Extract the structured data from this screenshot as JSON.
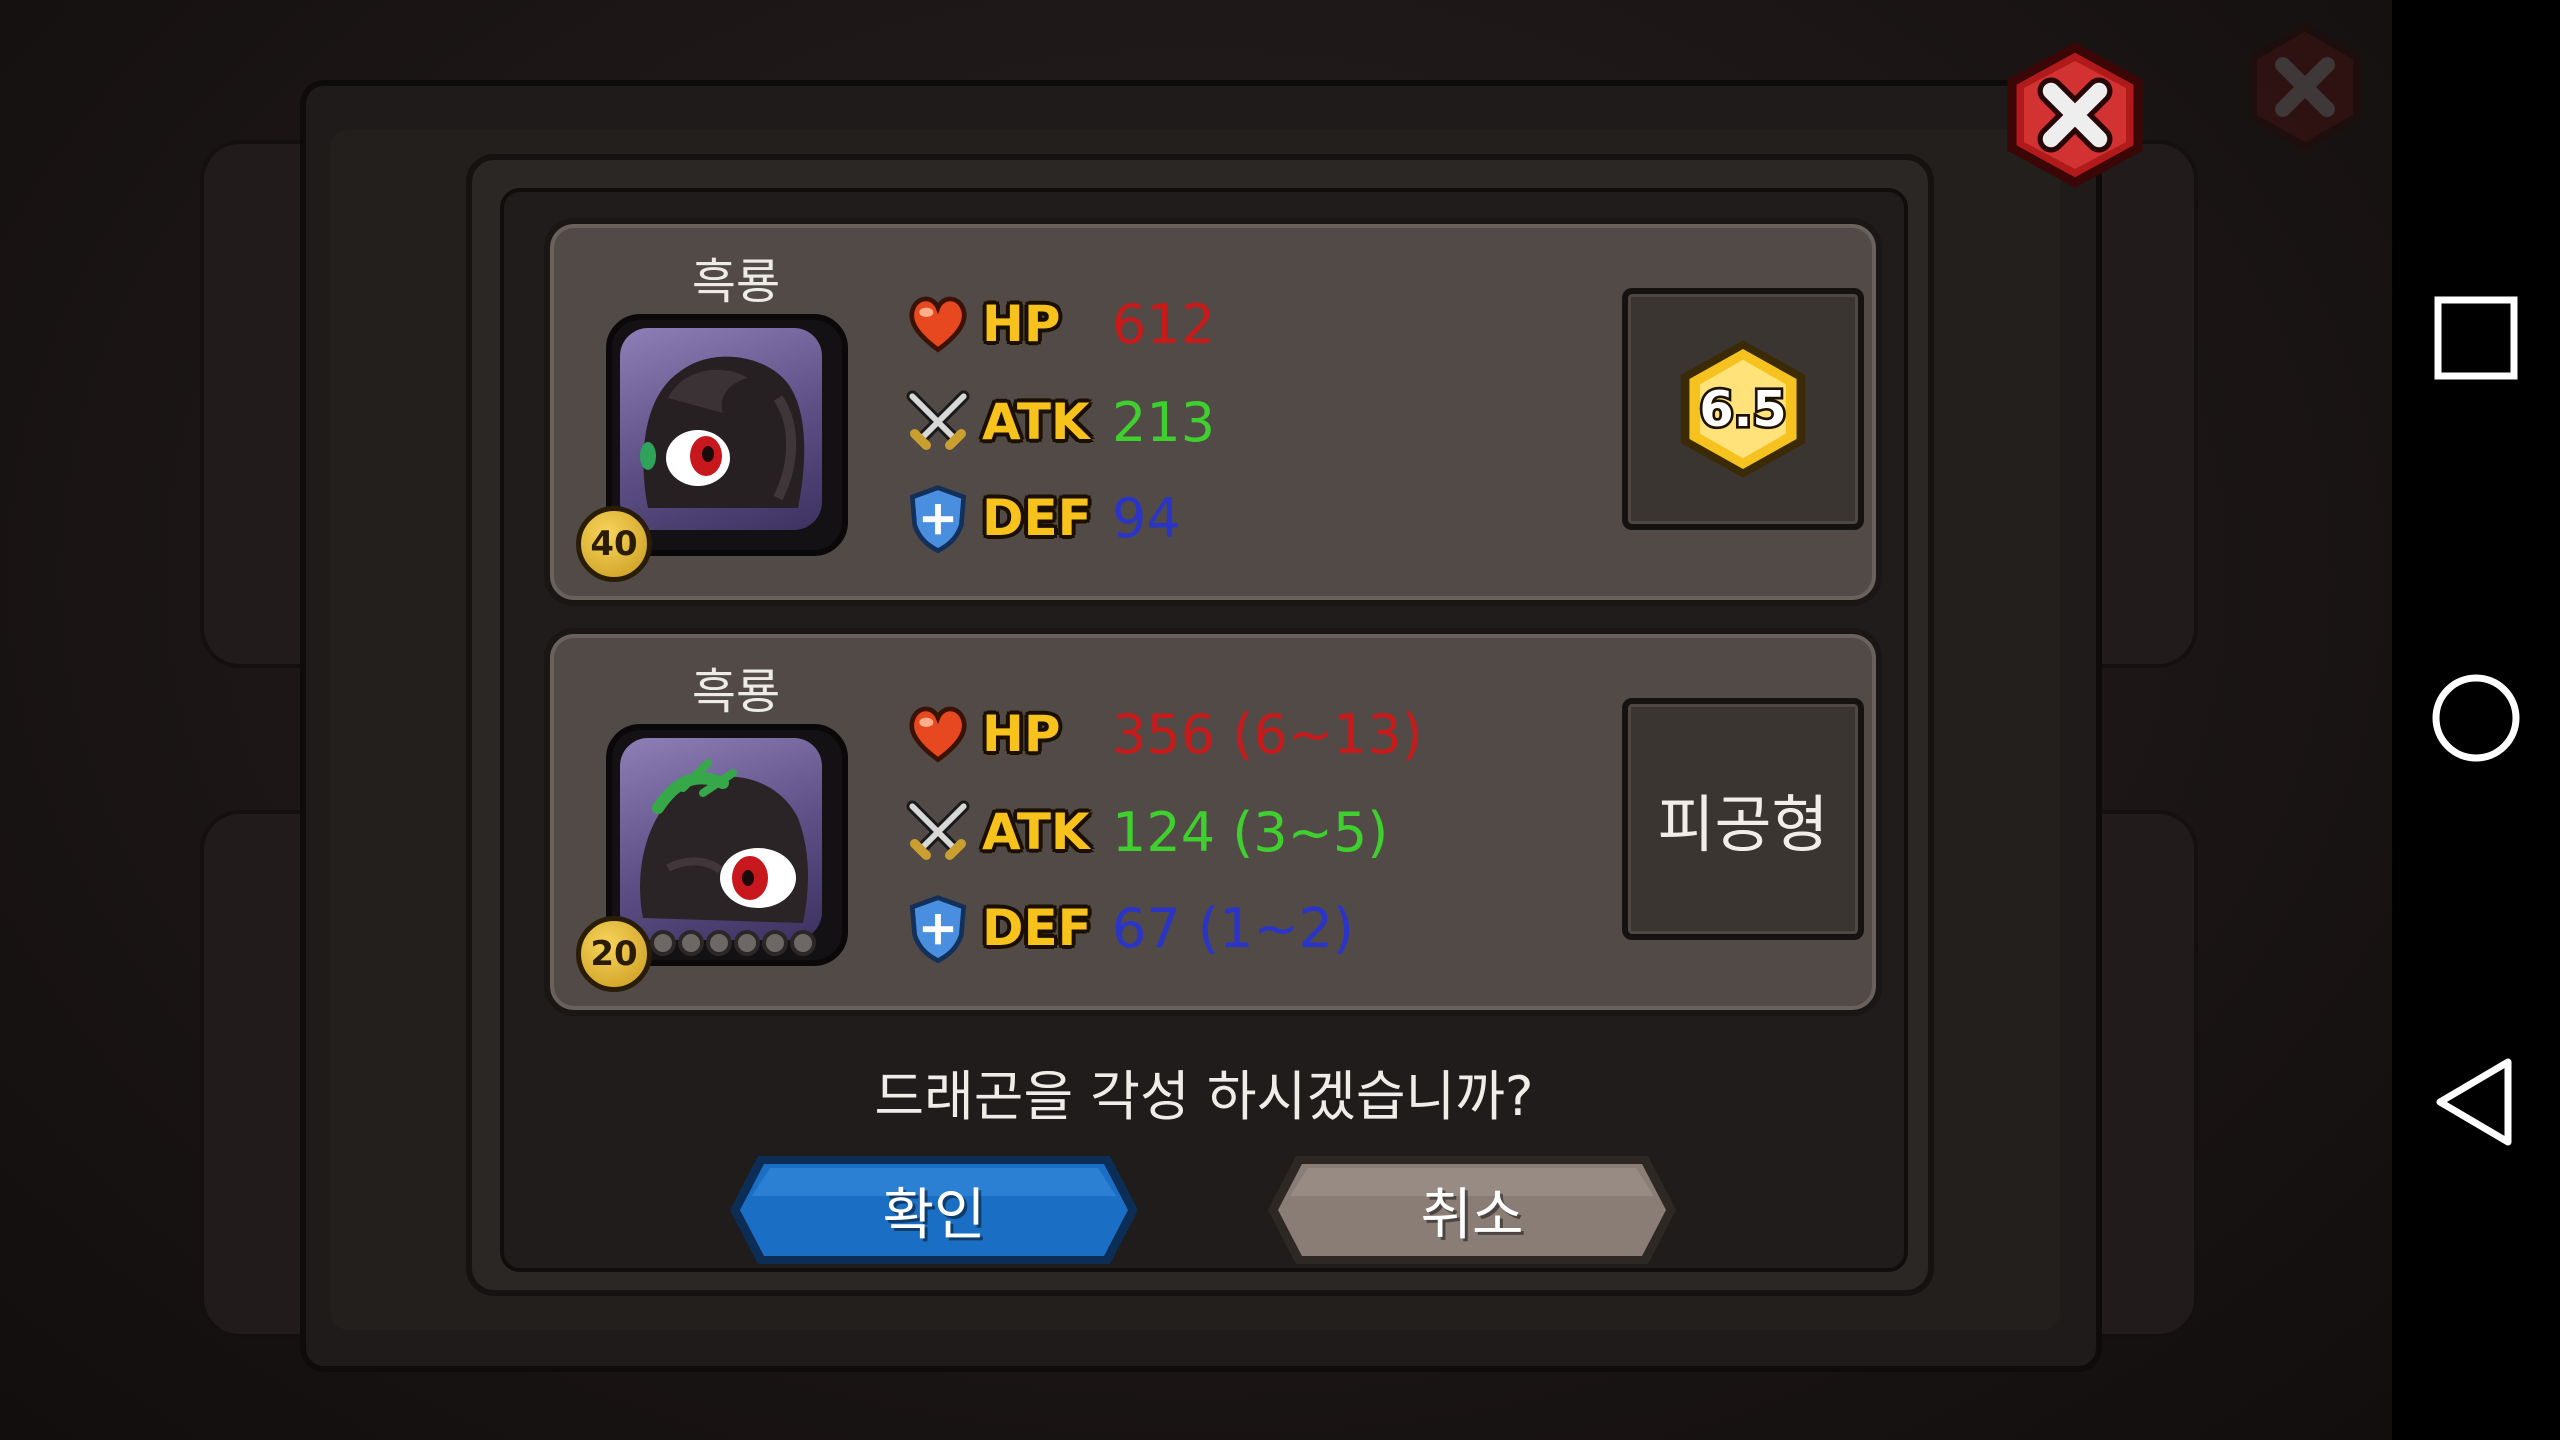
{
  "dragons": [
    {
      "name": "흑룡",
      "level": "40",
      "stats": {
        "hp_label": "HP",
        "hp_value": "612",
        "atk_label": "ATK",
        "atk_value": "213",
        "def_label": "DEF",
        "def_value": "94"
      },
      "side_box": {
        "type": "grade-badge",
        "text": "6.5"
      }
    },
    {
      "name": "흑룡",
      "level": "20",
      "star_slots": 6,
      "stats": {
        "hp_label": "HP",
        "hp_value": "356 (6~13)",
        "atk_label": "ATK",
        "atk_value": "124 (3~5)",
        "def_label": "DEF",
        "def_value": "67 (1~2)"
      },
      "side_box": {
        "type": "type-label",
        "text": "피공형"
      }
    }
  ],
  "question": "드래곤을 각성 하시겠습니까?",
  "buttons": {
    "confirm_label": "확인",
    "cancel_label": "취소"
  },
  "icons": {
    "hp": "heart-icon",
    "atk": "crossed-swords-icon",
    "def": "shield-icon",
    "close": "close-icon",
    "nav_recents": "square-icon",
    "nav_home": "circle-icon",
    "nav_back": "triangle-back-icon"
  },
  "colors": {
    "hp": "#c71b1b",
    "atk": "#3fcf2e",
    "def": "#2a34c8",
    "stat_label": "#f7c21b",
    "confirm_button": "#1a6fc4",
    "cancel_button": "#8a7d75"
  }
}
